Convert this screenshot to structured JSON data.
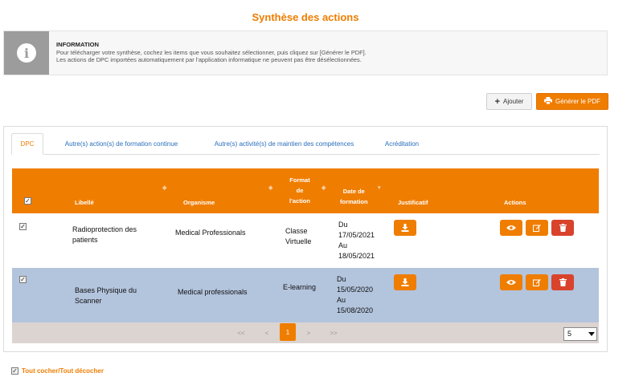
{
  "page": {
    "title": "Synthèse des actions"
  },
  "info": {
    "title": "INFORMATION",
    "line1": "Pour télécharger votre synthèse, cochez les items que vous souhaitez sélectionner, puis cliquez sur [Générer le PDF].",
    "line2": "Les actions de DPC importées automatiquement par l'application informatique ne peuvent pas être désélectionnées."
  },
  "toolbar": {
    "add_label": "Ajouter",
    "pdf_label": "Générer le PDF"
  },
  "tabs": [
    {
      "label": "DPC",
      "active": true
    },
    {
      "label": "Autre(s) action(s) de formation continue",
      "active": false
    },
    {
      "label": "Autre(s) activité(s) de maintien des compétences",
      "active": false
    },
    {
      "label": "Acréditation",
      "active": false
    }
  ],
  "table": {
    "headers": {
      "libelle": "Libellé",
      "organisme": "Organisme",
      "format_line1": "Format",
      "format_line2": "de",
      "format_line3": "l'action",
      "date_line1": "Date de",
      "date_line2": "formation",
      "justificatif": "Justificatif",
      "actions": "Actions"
    },
    "rows": [
      {
        "checked": true,
        "libelle_line1": "Radioprotection des",
        "libelle_line2": "patients",
        "organisme": "Medical Professionals",
        "format_line1": "Classe",
        "format_line2": "Virtuelle",
        "date_line1": "Du",
        "date_line2": "17/05/2021",
        "date_line3": "Au",
        "date_line4": "18/05/2021"
      },
      {
        "checked": true,
        "libelle_line1": "Bases Physique du",
        "libelle_line2": "Scanner",
        "organisme": "Medical professionals",
        "format_line1": "E-learning",
        "format_line2": "",
        "date_line1": "Du",
        "date_line2": "15/05/2020",
        "date_line3": "Au",
        "date_line4": "15/08/2020"
      }
    ]
  },
  "pagination": {
    "first": "<<",
    "prev": "<",
    "current": "1",
    "next": ">",
    "last": ">>",
    "page_size": "5"
  },
  "footer": {
    "check_all_label": "Tout cocher/Tout décocher"
  },
  "colors": {
    "accent": "#ef7d00",
    "row_alt": "#b3c4dd",
    "danger": "#d9432c",
    "tab_link": "#2a6ebb"
  },
  "icons": {
    "info": "info-icon",
    "add": "plus-icon",
    "pdf": "printer-icon",
    "download": "download-icon",
    "view": "eye-icon",
    "edit": "edit-icon",
    "delete": "trash-icon"
  }
}
